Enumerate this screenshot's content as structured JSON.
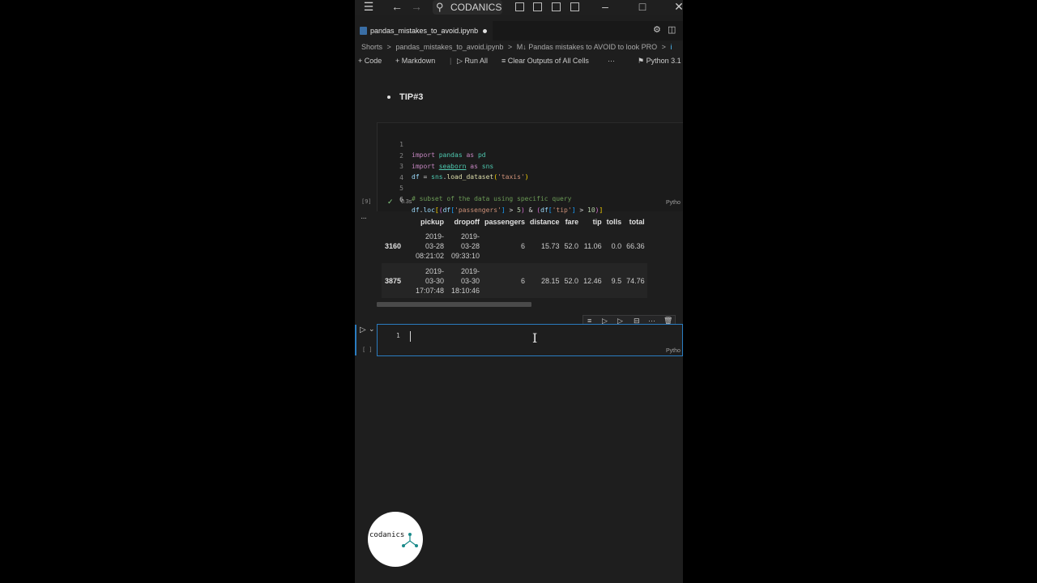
{
  "titlebar": {
    "search_text": "CODANICS",
    "icons": [
      "menu-icon",
      "back-arrow-icon",
      "forward-arrow-icon",
      "search-icon",
      "toggle-primary-sidebar-icon",
      "toggle-panel-icon",
      "toggle-secondary-sidebar-icon",
      "customize-layout-icon",
      "minimize-icon",
      "maximize-icon",
      "close-icon"
    ]
  },
  "tab": {
    "label": "pandas_mistakes_to_avoid.ipynb",
    "unsaved": true
  },
  "breadcrumb": [
    "Shorts",
    ">",
    "pandas_mistakes_to_avoid.ipynb",
    ">",
    "M↓ Pandas mistakes to AVOID to look PRO",
    ">",
    "i"
  ],
  "toolbar": {
    "code": "Code",
    "markdown": "Markdown",
    "run_all": "Run All",
    "clear_outputs": "Clear Outputs of All Cells",
    "more": "···",
    "kernel": "Python 3.1"
  },
  "markdown_cell": {
    "text": "TIP#3"
  },
  "code_cell": {
    "execution_count": "[9]",
    "exec_time": "0.3s",
    "language": "Pytho",
    "line_numbers": [
      "1",
      "2",
      "3",
      "4",
      "5",
      "6"
    ],
    "lines": [
      "import pandas as pd",
      "import seaborn as sns",
      "df = sns.load_dataset('taxis')",
      "",
      "# subset of the data using specific query",
      "df.loc[(df['passengers'] > 5) & (df['tip'] > 10)]"
    ]
  },
  "output": {
    "more": "···",
    "columns": [
      "",
      "pickup",
      "dropoff",
      "passengers",
      "distance",
      "fare",
      "tip",
      "tolls",
      "total"
    ],
    "rows": [
      {
        "index": "3160",
        "pickup": [
          "2019-",
          "03-28",
          "08:21:02"
        ],
        "dropoff": [
          "2019-",
          "03-28",
          "09:33:10"
        ],
        "passengers": "6",
        "distance": "15.73",
        "fare": "52.0",
        "tip": "11.06",
        "tolls": "0.0",
        "total": "66.36"
      },
      {
        "index": "3875",
        "pickup": [
          "2019-",
          "03-30",
          "17:07:48"
        ],
        "dropoff": [
          "2019-",
          "03-30",
          "18:10:46"
        ],
        "passengers": "6",
        "distance": "28.15",
        "fare": "52.0",
        "tip": "12.46",
        "tolls": "9.5",
        "total": "74.76"
      }
    ]
  },
  "empty_cell": {
    "execution_count": "[ ]",
    "line_number": "1",
    "language": "Pytho"
  },
  "logo": {
    "text": "codanics"
  },
  "colors": {
    "accent": "#2a7cc0",
    "background": "#1e1e1e",
    "keyword": "#c586c0",
    "string": "#ce9178",
    "comment": "#6a9955"
  }
}
